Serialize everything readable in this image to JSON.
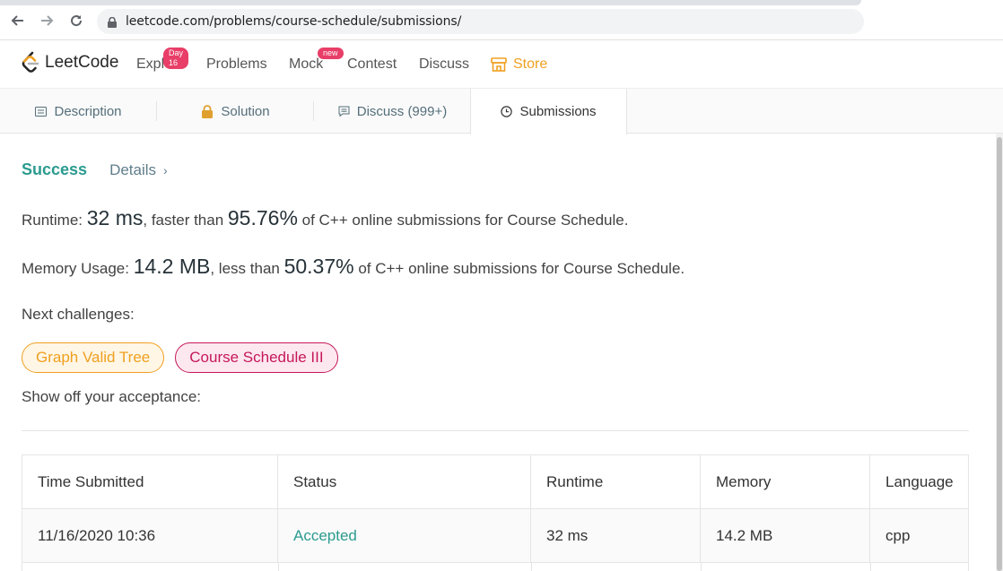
{
  "browser": {
    "url": "leetcode.com/problems/course-schedule/submissions/"
  },
  "header": {
    "brand": "LeetCode",
    "nav": [
      {
        "label": "Explore",
        "badge": "Day 16"
      },
      {
        "label": "Problems"
      },
      {
        "label": "Mock",
        "badge": "new"
      },
      {
        "label": "Contest"
      },
      {
        "label": "Discuss"
      },
      {
        "label": "Store"
      }
    ]
  },
  "tabs": [
    {
      "label": "Description",
      "icon": "description-icon"
    },
    {
      "label": "Solution",
      "icon": "lock-icon"
    },
    {
      "label": "Discuss (999+)",
      "icon": "discuss-icon"
    },
    {
      "label": "Submissions",
      "icon": "clock-icon",
      "active": true
    }
  ],
  "result": {
    "status": "Success",
    "details": "Details"
  },
  "runtime": {
    "label": "Runtime: ",
    "value": "32 ms",
    "mid": ", faster than ",
    "percent": "95.76%",
    "suffix": " of C++ online submissions for Course Schedule."
  },
  "memory": {
    "label": "Memory Usage: ",
    "value": "14.2 MB",
    "mid": ", less than ",
    "percent": "50.37%",
    "suffix": " of C++ online submissions for Course Schedule."
  },
  "next_challenges": {
    "label": "Next challenges:",
    "items": [
      "Graph Valid Tree",
      "Course Schedule III"
    ]
  },
  "show_off": "Show off your acceptance:",
  "table": {
    "headers": [
      "Time Submitted",
      "Status",
      "Runtime",
      "Memory",
      "Language"
    ],
    "rows": [
      [
        "11/16/2020 10:36",
        "Accepted",
        "32 ms",
        "14.2 MB",
        "cpp"
      ]
    ]
  },
  "colors": {
    "accent_green": "#2b9b8f",
    "store_orange": "#f0a020",
    "badge_pink": "#e83e68"
  }
}
